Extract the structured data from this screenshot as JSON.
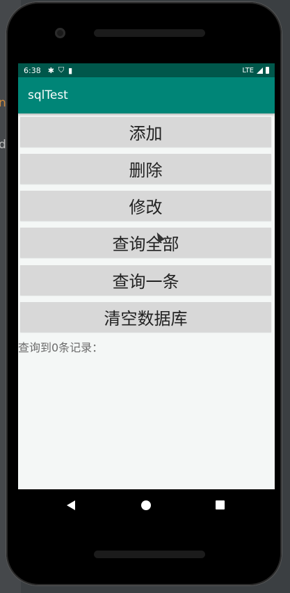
{
  "status_bar": {
    "time": "6:38",
    "network": "LTE",
    "icons": [
      "gear-icon",
      "shield-icon",
      "sim-card-icon",
      "signal-icon",
      "battery-icon"
    ]
  },
  "app_bar": {
    "title": "sqlTest"
  },
  "buttons": {
    "add": "添加",
    "delete": "删除",
    "modify": "修改",
    "query_all": "查询全部",
    "query_one": "查询一条",
    "clear_db": "清空数据库"
  },
  "result_text": "查询到0条记录：",
  "colors": {
    "status_bar": "#00574b",
    "app_bar": "#008577",
    "button": "#d8d8d8",
    "screen_bg": "#f4f7f6"
  }
}
